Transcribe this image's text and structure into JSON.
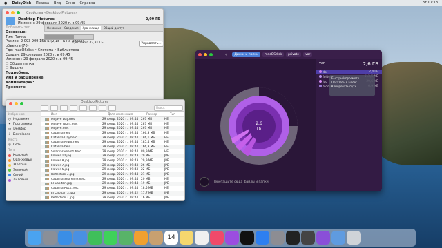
{
  "menubar": {
    "app": "DaisyDisk",
    "items": [
      "Правка",
      "Вид",
      "Окно",
      "Справка"
    ],
    "right": [
      "Вт 07:18"
    ]
  },
  "info_window": {
    "title": "Свойства «Desktop Pictures»",
    "folder_name": "Desktop Pictures",
    "size": "2,09 ГБ",
    "modified": "Изменен: 29 февраля 2020 г. в 09:45",
    "tag_placeholder": "Добавить тег...",
    "section_general": "Основные:",
    "kind": "Тип: Папка",
    "size_detail": "Размер: 2 093 909 156 Б (2,18 ГБ на диске),",
    "items": "объекта (70)",
    "where": "Где: macOSdisk • Система • Библиотека",
    "created": "Создан: 29 февраля 2020 г. в 09:45",
    "changed": "Изменен: 29 февраля 2020 г. в 09:45",
    "shared_folder": "Общая папка",
    "locked": "Защита",
    "more_info": "Подробнее:",
    "name_ext": "Имя и расширение:",
    "comments": "Комментарии:",
    "preview": "Просмотр:",
    "tabs": [
      "Основные",
      "Сведения",
      "Хранилище",
      "Общий доступ"
    ],
    "storage_label": "1,87 ГБ из 42,81 ГБ",
    "manage_button": "Управлять..."
  },
  "finder": {
    "title": "Desktop Pictures",
    "search_placeholder": "Поиск",
    "sidebar": {
      "favorites_header": "Избранное",
      "favorites": [
        "Недавние",
        "Программы",
        "Desktop",
        "Downloads"
      ],
      "places_header": "Места",
      "places": [
        "Сеть"
      ],
      "tags_header": "Теги",
      "tags": [
        {
          "label": "Красный",
          "color": "#f0524f"
        },
        {
          "label": "Оранжевый",
          "color": "#f7952e"
        },
        {
          "label": "Желтый",
          "color": "#f6c945"
        },
        {
          "label": "Зеленый",
          "color": "#5fc63b"
        },
        {
          "label": "Синий",
          "color": "#3d8ef0"
        },
        {
          "label": "Лиловый",
          "color": "#a65bd6"
        }
      ]
    },
    "columns": {
      "name": "Имя",
      "date": "Дата изменения",
      "size": "Размер",
      "kind": "Тип"
    },
    "files": [
      {
        "name": "Mojave Day.heic",
        "date": "29 февр. 2020 г., 09:44",
        "size": "267 МБ",
        "kind": "HEI"
      },
      {
        "name": "Mojave Night.heic",
        "date": "29 февр. 2020 г., 09:44",
        "size": "287 МБ",
        "kind": "HEI"
      },
      {
        "name": "Mojave.heic",
        "date": "29 февр. 2020 г., 09:44",
        "size": "267 МБ",
        "kind": "HEI"
      },
      {
        "name": "Catalina.heic",
        "date": "29 февр. 2020 г., 09:44",
        "size": "166,3 МБ",
        "kind": "HEI"
      },
      {
        "name": "Catalina Day.heic",
        "date": "29 февр. 2020 г., 09:44",
        "size": "186,1 МБ",
        "kind": "HEI"
      },
      {
        "name": "Catalina Night.heic",
        "date": "29 февр. 2020 г., 09:44",
        "size": "185,4 МБ",
        "kind": "HEI"
      },
      {
        "name": "Catalina.heic",
        "date": "29 февр. 2020 г., 09:44",
        "size": "166,3 МБ",
        "kind": "HEI"
      },
      {
        "name": "Solar Gradients.heic",
        "date": "29 февр. 2020 г., 09:44",
        "size": "80,9 МБ",
        "kind": "HEI"
      },
      {
        "name": "Flower 10.jpg",
        "date": "29 февр. 2020 г., 09:43",
        "size": "20 МБ",
        "kind": "JPE"
      },
      {
        "name": "Flower 8.jpg",
        "date": "29 февр. 2020 г., 09:43",
        "size": "29,9 МБ",
        "kind": "JPE"
      },
      {
        "name": "Flower 7.jpg",
        "date": "29 февр. 2020 г., 09:43",
        "size": "26 МБ",
        "kind": "JPE"
      },
      {
        "name": "Flower 5.jpg",
        "date": "29 февр. 2020 г., 09:43",
        "size": "22 МБ",
        "kind": "JPE"
      },
      {
        "name": "Reflection 3.jpg",
        "date": "29 февр. 2020 г., 09:44",
        "size": "21 МБ",
        "kind": "JPE"
      },
      {
        "name": "Catalina Shoreline.heic",
        "date": "29 февр. 2020 г., 09:44",
        "size": "20 МБ",
        "kind": "HEI"
      },
      {
        "name": "El Capitan.jpg",
        "date": "29 февр. 2020 г., 09:44",
        "size": "19 МБ",
        "kind": "JPE"
      },
      {
        "name": "Catalina Rock.heic",
        "date": "29 февр. 2020 г., 09:44",
        "size": "18,5 МБ",
        "kind": "HEI"
      },
      {
        "name": "El Capitan 2.jpg",
        "date": "29 февр. 2020 г., 09:42",
        "size": "17,7 МБ",
        "kind": "JPE"
      },
      {
        "name": "Reflection 2.jpg",
        "date": "29 февр. 2020 г., 09:44",
        "size": "16 МБ",
        "kind": "JPE"
      },
      {
        "name": "Yosemite 4.jpg",
        "date": "29 февр. 2020 г., 09:44",
        "size": "15 МБ",
        "kind": "JPE"
      }
    ]
  },
  "daisydisk": {
    "breadcrumbs": [
      "Диски и папки",
      "macOSdisk",
      "private",
      "var"
    ],
    "folder": "var",
    "folder_size": "2,6 ГБ",
    "center_label": "2,6",
    "center_unit": "ГБ",
    "rows": [
      {
        "name": "db",
        "size": "2,4 ГБ",
        "color": "#c77df0"
      },
      {
        "name": "folders",
        "size": "113,5 МБ",
        "color": "#b890e8"
      },
      {
        "name": "log",
        "size": "29,6 МБ",
        "color": "#d98ef5"
      },
      {
        "name": "hidden space",
        "size": "6,9 МБ",
        "color": "#9c7bd3"
      }
    ],
    "tooltip": [
      "Быстрый просмотр",
      "Показать в Finder",
      "Копировать путь"
    ],
    "drop_hint": "Перетащите сюда файлы и папки",
    "accent": "#4c7fd8"
  },
  "dock": {
    "icons": [
      "finder-icon",
      "launchpad-icon",
      "safari-icon",
      "mail-icon",
      "facetime-icon",
      "messages-icon",
      "maps-icon",
      "photos-icon",
      "contacts-icon",
      "calendar-icon",
      "notes-icon",
      "reminders-icon",
      "music-icon",
      "podcasts-icon",
      "tv-icon",
      "appstore-icon",
      "settings-icon",
      "terminal-icon",
      "activity-icon",
      "daisydisk-icon",
      "downloads-icon",
      "trash-icon"
    ],
    "calendar_day": "14"
  }
}
